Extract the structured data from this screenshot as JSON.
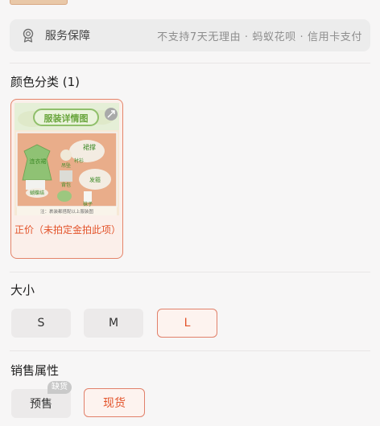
{
  "service": {
    "icon": "shield-badge-icon",
    "label": "服务保障",
    "text": "不支持7天无理由 · 蚂蚁花呗 · 信用卡支付"
  },
  "color_section": {
    "title": "颜色分类 (1)",
    "options": [
      {
        "image_banner": "服装详情图",
        "image_labels": [
          "连衣裙",
          "裙撑",
          "衬衫",
          "吊坠",
          "发箍",
          "背包",
          "蝴蝶结",
          "袜子"
        ],
        "image_footnote": "注：裹装都搭配以上服装图",
        "caption": "正价（未拍定金拍此项）",
        "selected": true
      }
    ]
  },
  "size_section": {
    "title": "大小",
    "options": [
      {
        "label": "S",
        "selected": false
      },
      {
        "label": "M",
        "selected": false
      },
      {
        "label": "L",
        "selected": true
      }
    ]
  },
  "sale_section": {
    "title": "销售属性",
    "options": [
      {
        "label": "预售",
        "badge": "缺货",
        "selected": false
      },
      {
        "label": "现货",
        "selected": true
      }
    ]
  },
  "colors": {
    "accent": "#e3532a",
    "accent_border": "#e1806a",
    "chip_bg": "#eceaea",
    "page_bg": "#f7f6f6"
  }
}
